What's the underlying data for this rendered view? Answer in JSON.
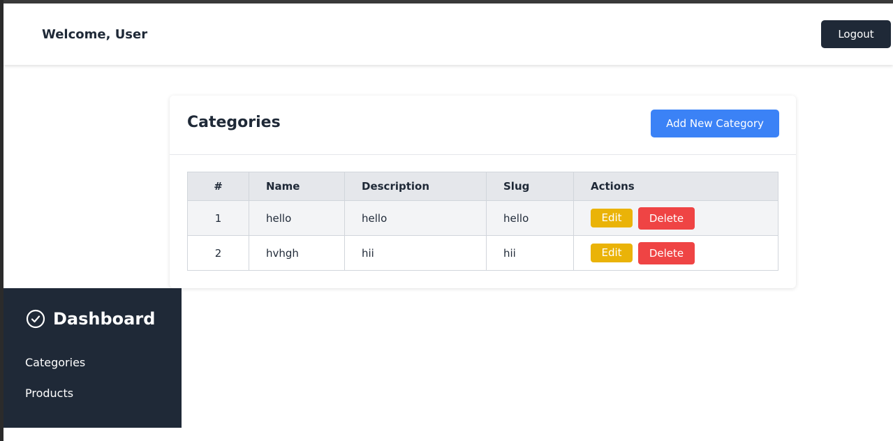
{
  "header": {
    "welcome": "Welcome, User",
    "logout_label": "Logout"
  },
  "main": {
    "title": "Categories",
    "add_label": "Add New Category",
    "columns": [
      "#",
      "Name",
      "Description",
      "Slug",
      "Actions"
    ],
    "rows": [
      {
        "num": "1",
        "name": "hello",
        "description": "hello",
        "slug": "hello"
      },
      {
        "num": "2",
        "name": "hvhgh",
        "description": "hii",
        "slug": "hii"
      }
    ],
    "edit_label": "Edit",
    "delete_label": "Delete"
  },
  "sidebar": {
    "title": "Dashboard",
    "icon": "check-circle-icon",
    "items": [
      {
        "label": "Categories"
      },
      {
        "label": "Products"
      }
    ]
  },
  "colors": {
    "dark": "#1f2937",
    "primary": "#3b82f6",
    "edit": "#eab308",
    "delete": "#ef4444"
  }
}
